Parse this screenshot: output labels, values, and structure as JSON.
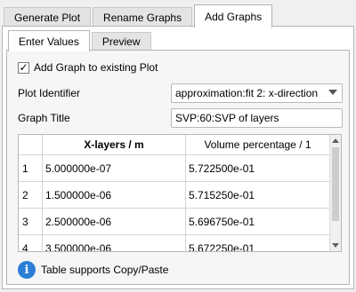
{
  "top_tabs": [
    {
      "label": "Generate Plot",
      "active": false
    },
    {
      "label": "Rename Graphs",
      "active": false
    },
    {
      "label": "Add Graphs",
      "active": true
    }
  ],
  "inner_tabs": [
    {
      "label": "Enter Values",
      "active": true
    },
    {
      "label": "Preview",
      "active": false
    }
  ],
  "form": {
    "add_to_existing_label": "Add Graph to existing Plot",
    "add_to_existing_checked": true,
    "checkmark": "✓",
    "plot_identifier_label": "Plot Identifier",
    "plot_identifier_value": "approximation:fit 2: x-direction",
    "graph_title_label": "Graph Title",
    "graph_title_value": "SVP:60:SVP of layers"
  },
  "table": {
    "columns": [
      "X-layers / m",
      "Volume percentage / 1"
    ],
    "rows": [
      {
        "index": "1",
        "x": "5.000000e-07",
        "v": "5.722500e-01"
      },
      {
        "index": "2",
        "x": "1.500000e-06",
        "v": "5.715250e-01"
      },
      {
        "index": "3",
        "x": "2.500000e-06",
        "v": "5.696750e-01"
      },
      {
        "index": "4",
        "x": "3.500000e-06",
        "v": "5.672250e-01"
      }
    ]
  },
  "info": {
    "icon": "info-icon",
    "icon_glyph": "i",
    "text": "Table supports Copy/Paste",
    "icon_color": "#2b7fd6"
  }
}
